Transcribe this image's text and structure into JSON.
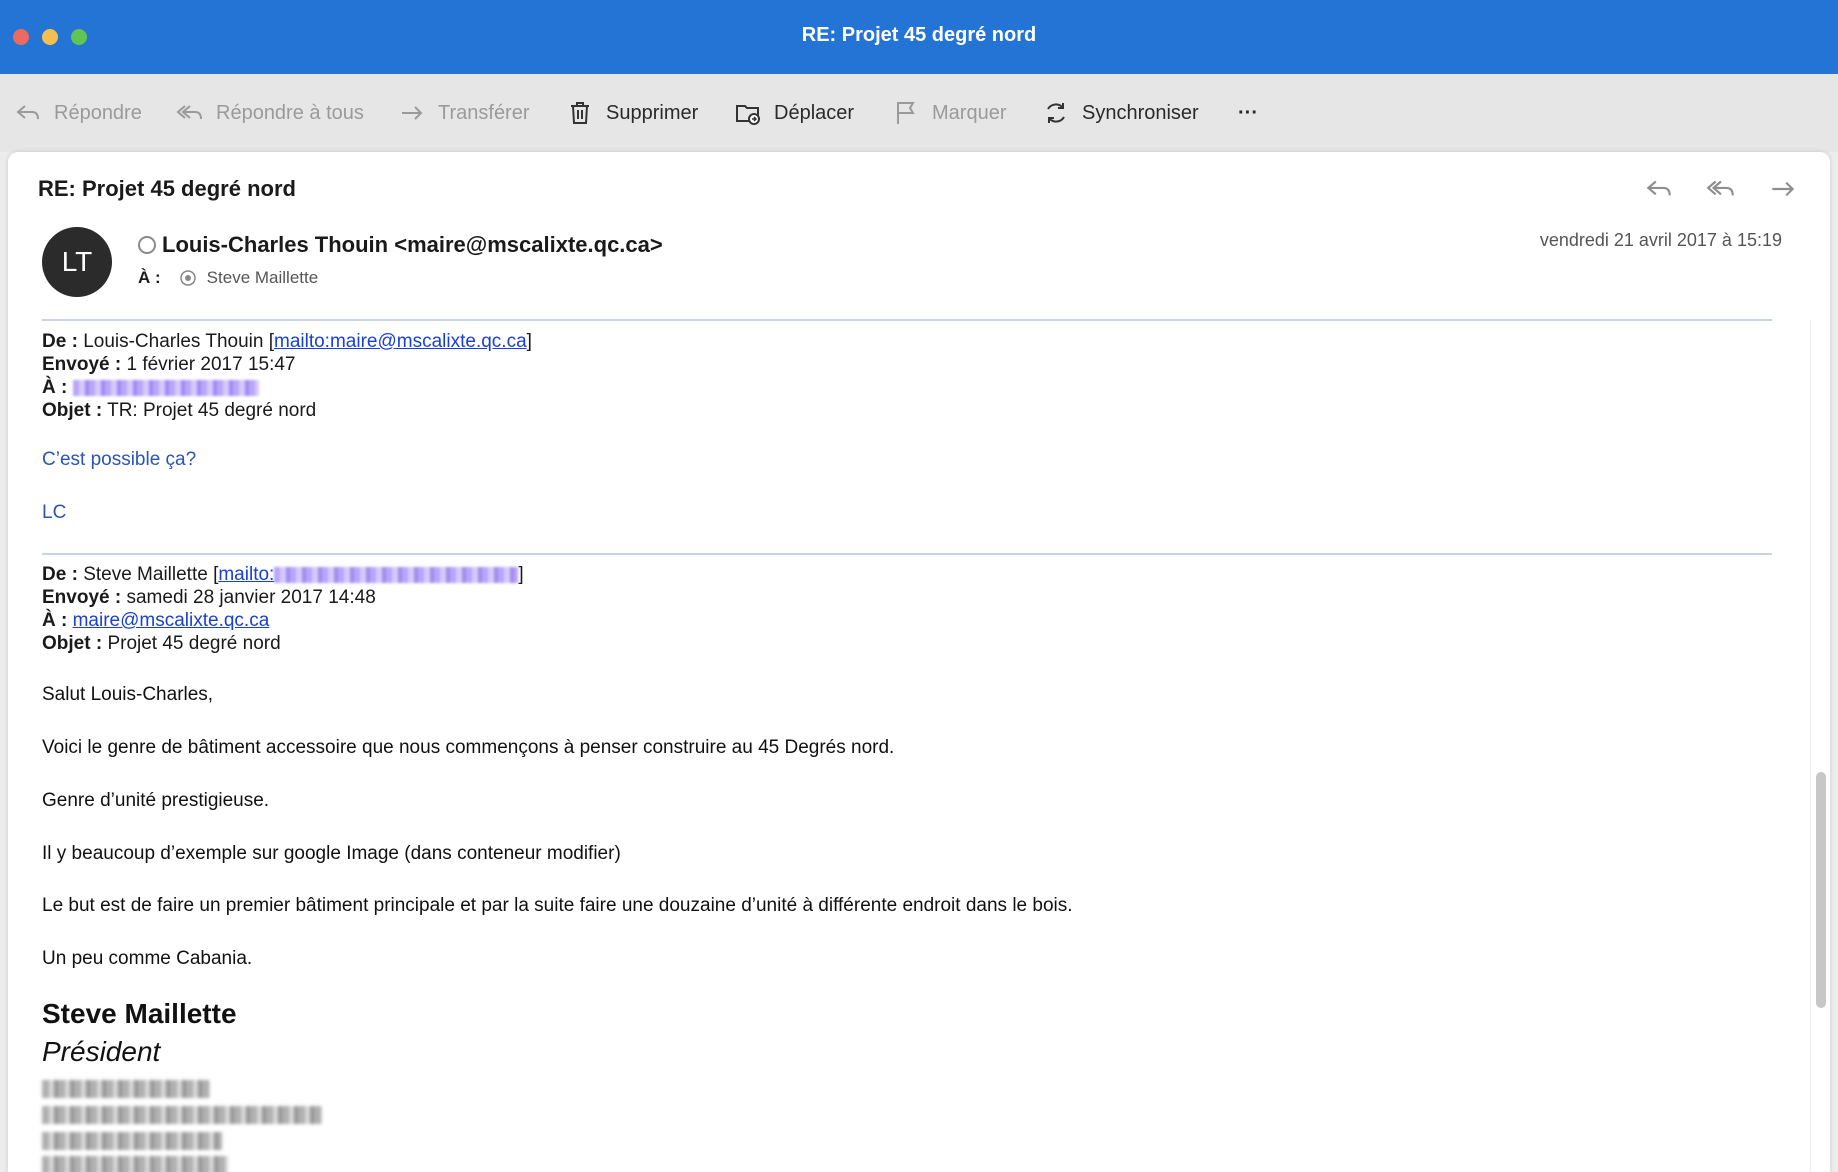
{
  "window": {
    "title": "RE: Projet 45 degré nord"
  },
  "toolbar": {
    "reply": "Répondre",
    "reply_all": "Répondre à tous",
    "forward": "Transférer",
    "delete": "Supprimer",
    "move": "Déplacer",
    "flag": "Marquer",
    "sync": "Synchroniser",
    "more": "···"
  },
  "message": {
    "subject": "RE: Projet 45 degré nord",
    "avatar_initials": "LT",
    "sender": "Louis-Charles Thouin <maire@mscalixte.qc.ca>",
    "to_label": "À :",
    "to_name": "Steve Maillette",
    "date": "vendredi 21 avril 2017 à 15:19"
  },
  "quote1": {
    "from_label": "De :",
    "from_name": "Louis-Charles Thouin [",
    "from_link": "mailto:maire@mscalixte.qc.ca",
    "from_close": "]",
    "sent_label": "Envoyé :",
    "sent_value": "1 février 2017 15:47",
    "to_label": "À :",
    "subject_label": "Objet :",
    "subject_value": "TR: Projet 45 degré nord",
    "line1": "C’est possible ça?",
    "line2": "LC"
  },
  "quote2": {
    "from_label": "De :",
    "from_name": "Steve Maillette [",
    "from_link": "mailto:",
    "from_close": "]",
    "sent_label": "Envoyé :",
    "sent_value": "samedi 28 janvier 2017 14:48",
    "to_label": "À :",
    "to_link": "maire@mscalixte.qc.ca",
    "subject_label": "Objet :",
    "subject_value": "Projet 45 degré nord",
    "greeting": "Salut Louis-Charles,",
    "p1": "Voici le genre de bâtiment accessoire que nous commençons à penser construire au 45 Degrés nord.",
    "p2": "Genre d’unité prestigieuse.",
    "p3": "Il y beaucoup d’exemple sur google Image (dans conteneur modifier)",
    "p4": "Le but est de faire un premier bâtiment principale et par la suite faire une douzaine d’unité à différente endroit dans le bois.",
    "p5": "Un peu comme Cabania.",
    "sig_name": "Steve Maillette",
    "sig_title": "Président"
  },
  "colors": {
    "titlebar": "#2374d5",
    "link": "#1a3fd6",
    "quote_text": "#2a55b5"
  }
}
